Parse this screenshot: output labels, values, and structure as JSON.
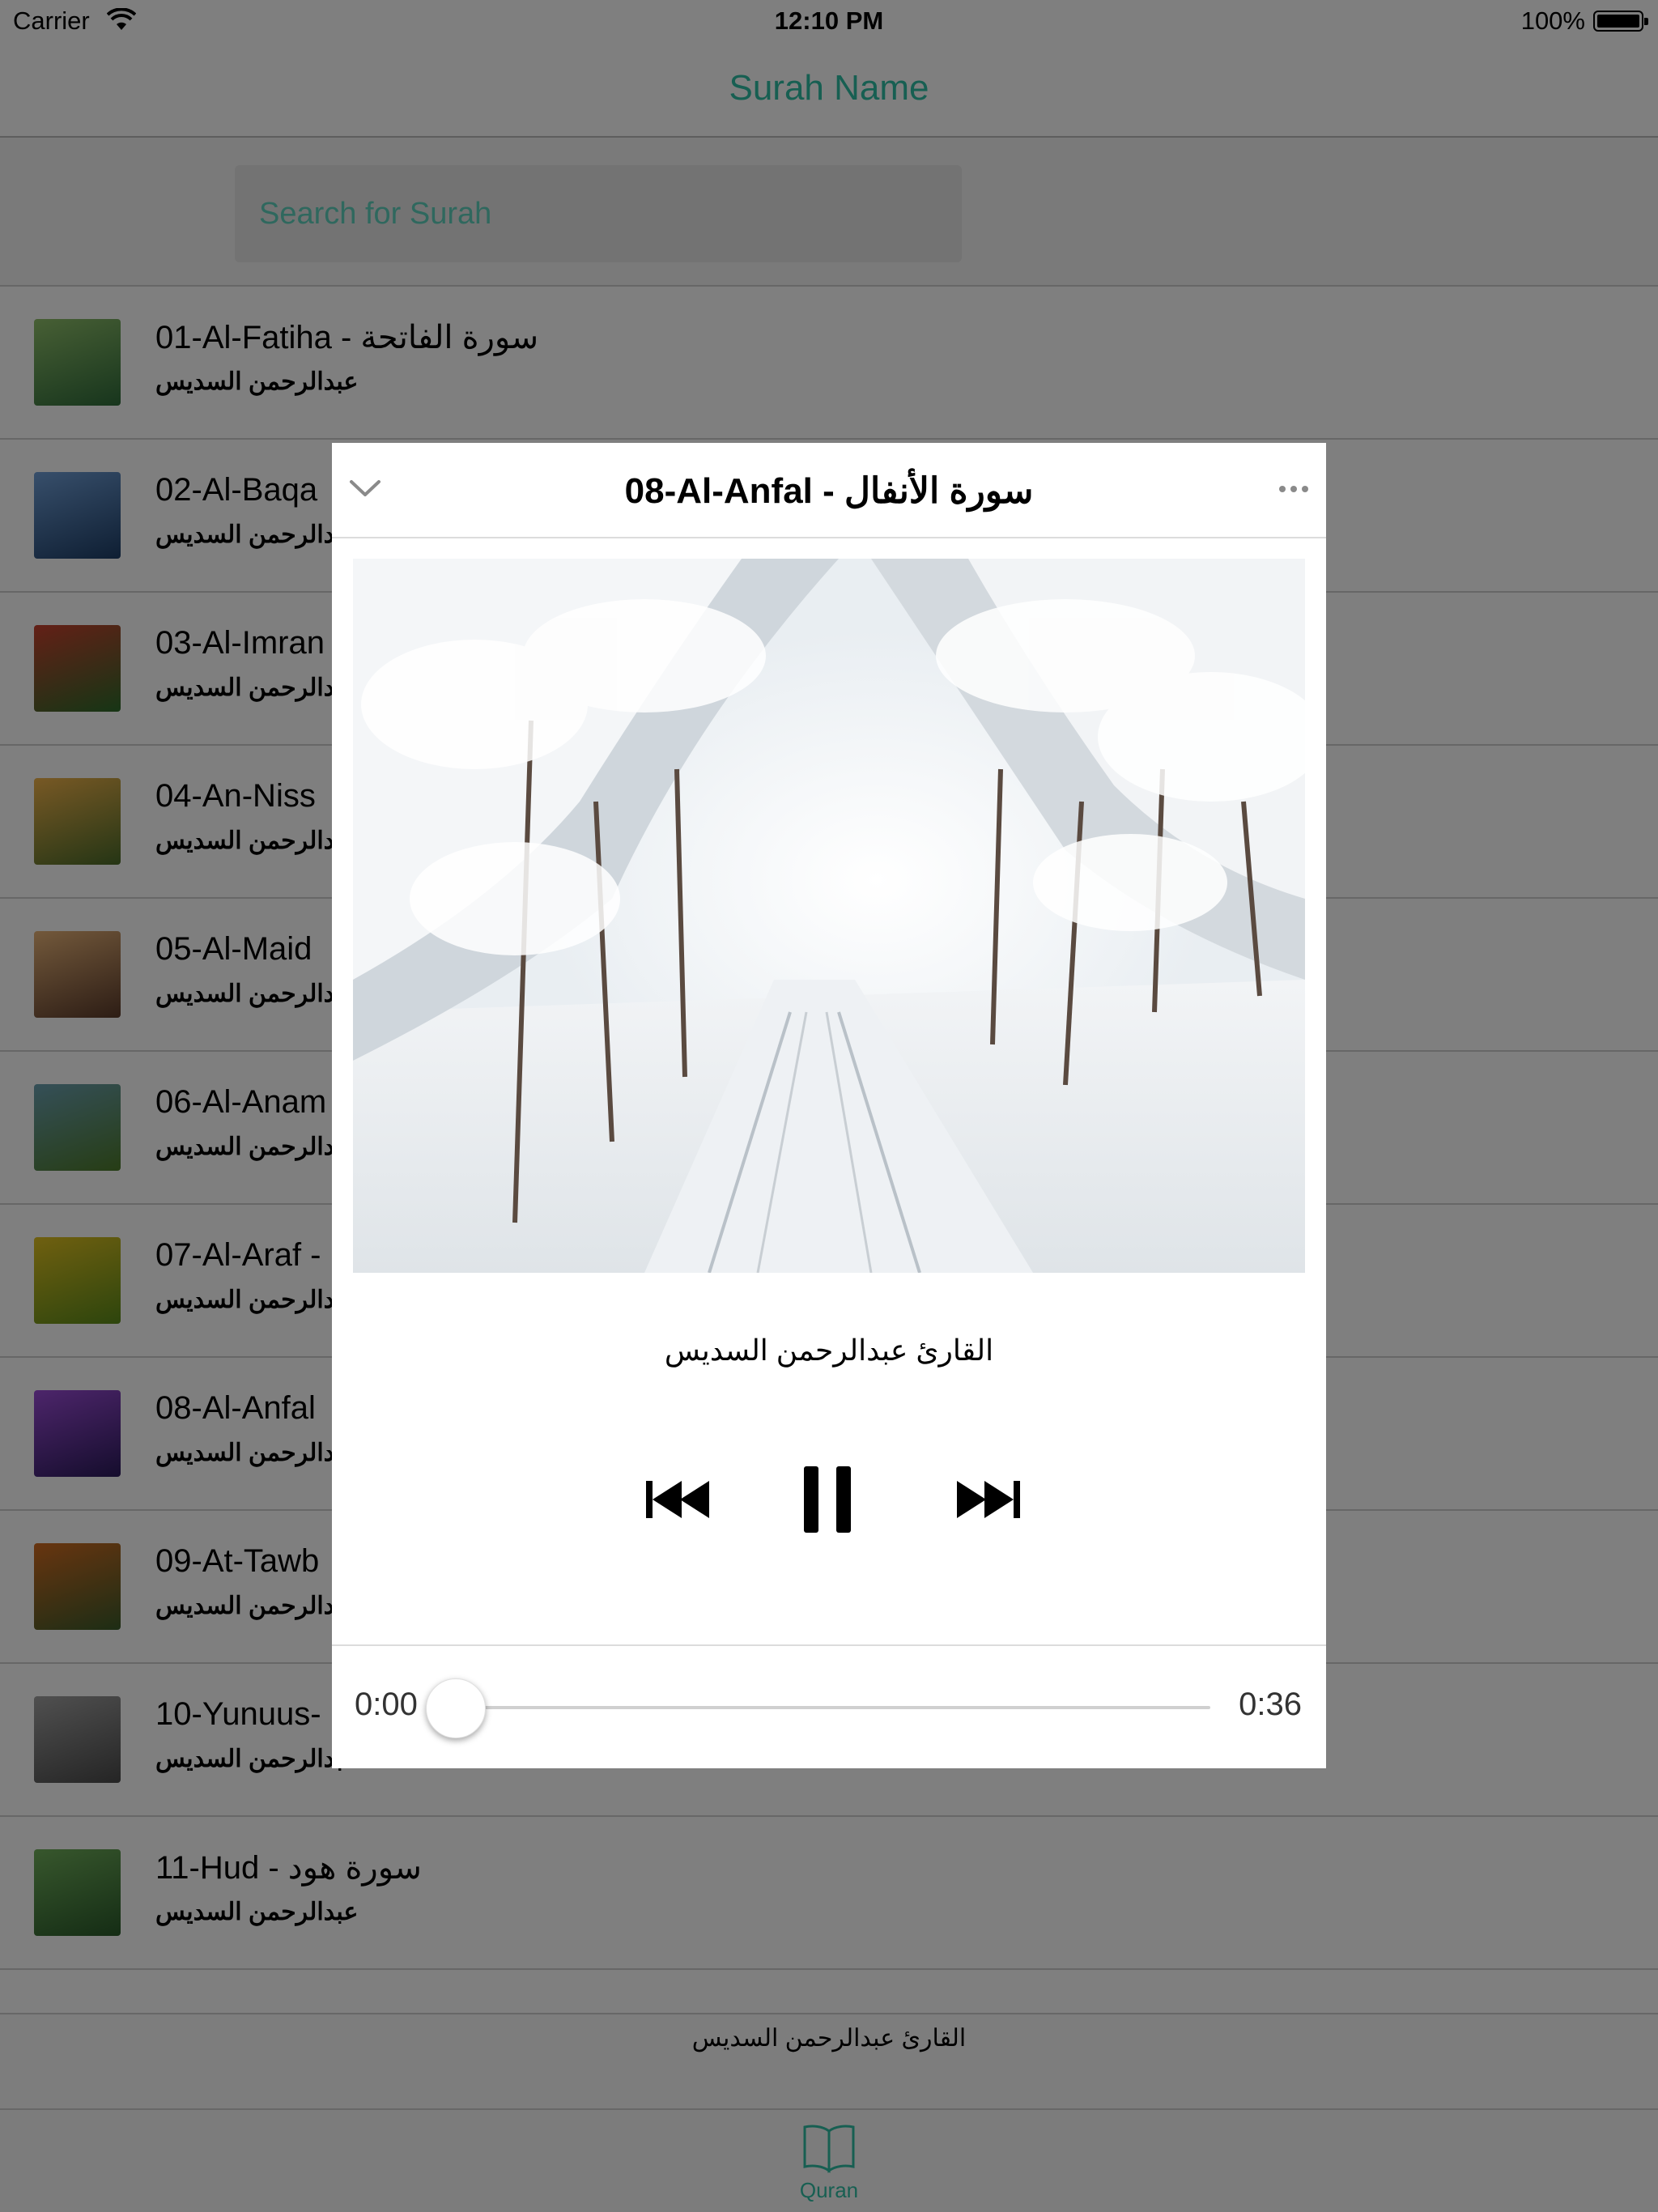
{
  "status_bar": {
    "carrier": "Carrier",
    "time": "12:10 PM",
    "battery": "100%"
  },
  "nav": {
    "title": "Surah Name"
  },
  "search": {
    "placeholder": "Search for Surah",
    "value": ""
  },
  "surahs": [
    {
      "name": "01-Al-Fatiha - سورة الفاتحة",
      "reciter": "عبدالرحمن السديس",
      "colors": [
        "#8fbf6a",
        "#2f6b3a"
      ]
    },
    {
      "name": "02-Al-Baqa",
      "reciter": "عبدالرحمن السديس",
      "colors": [
        "#6f9ed6",
        "#1d3d66"
      ]
    },
    {
      "name": "03-Al-Imran",
      "reciter": "عبدالرحمن السديس",
      "colors": [
        "#c7402e",
        "#2c6b2a"
      ]
    },
    {
      "name": "04-An-Niss",
      "reciter": "عبدالرحمن السديس",
      "colors": [
        "#f0b24a",
        "#4a6b2a"
      ]
    },
    {
      "name": "05-Al-Maid",
      "reciter": "عبدالرحمن السديس",
      "colors": [
        "#e6b277",
        "#5a3a2a"
      ]
    },
    {
      "name": "06-Al-Anam",
      "reciter": "عبدالرحمن السديس",
      "colors": [
        "#6a9fb0",
        "#4d7a2a"
      ]
    },
    {
      "name": "07-Al-Araf -",
      "reciter": "عبدالرحمن السديس",
      "colors": [
        "#e0c020",
        "#5a8a1a"
      ]
    },
    {
      "name": "08-Al-Anfal",
      "reciter": "عبدالرحمن السديس",
      "colors": [
        "#9a4bd6",
        "#2a1a5a"
      ]
    },
    {
      "name": "09-At-Tawb",
      "reciter": "عبدالرحمن السديس",
      "colors": [
        "#d06a20",
        "#3a5a2a"
      ]
    },
    {
      "name": "10-Yunuus-",
      "reciter": "عبدالرحمن السديس",
      "colors": [
        "#a0a0a0",
        "#4a4a4a"
      ]
    },
    {
      "name": "11-Hud - سورة هود",
      "reciter": "عبدالرحمن السديس",
      "colors": [
        "#6fae5a",
        "#2a5a2a"
      ]
    }
  ],
  "mini_player": {
    "title": "القارئ عبدالرحمن السديس"
  },
  "tab_bar": {
    "tabs": [
      {
        "label": "Quran",
        "icon": "book-open-icon"
      }
    ]
  },
  "player": {
    "title": "08-Al-Anfal  -  سورة الأنفال",
    "reciter": "القارئ عبدالرحمن السديس",
    "elapsed": "0:00",
    "duration": "0:36",
    "progress": 0.0,
    "state": "playing",
    "accent_color": "#2fbfa4"
  }
}
